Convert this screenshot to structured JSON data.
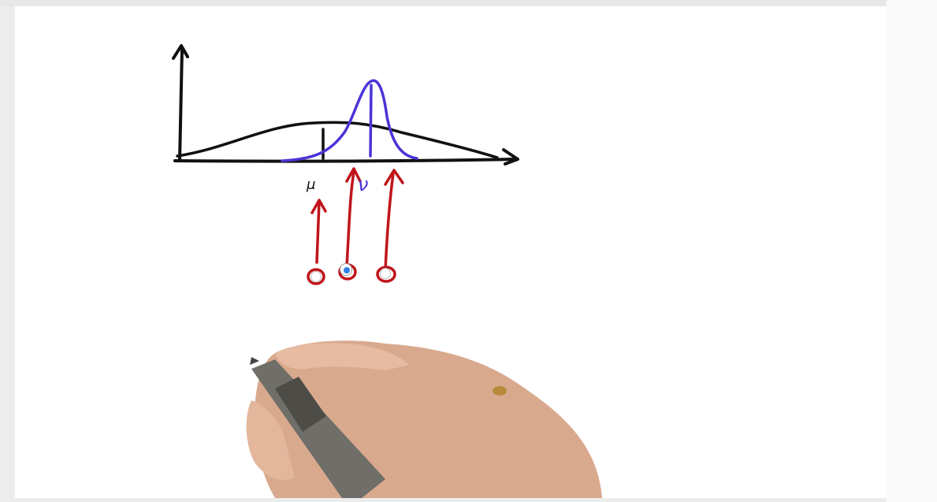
{
  "canvas": {
    "background": "#ffffff"
  },
  "labels": {
    "mu": "μ",
    "nu": "ν"
  },
  "colors": {
    "ink_black": "#111111",
    "ink_blue": "#4a35d6",
    "ink_red": "#c0151b",
    "selected_dot": "#2f7fe6"
  },
  "quiz": {
    "options": [
      {
        "id": "option-left",
        "selected": false
      },
      {
        "id": "option-middle",
        "selected": true
      },
      {
        "id": "option-right",
        "selected": false
      }
    ]
  }
}
